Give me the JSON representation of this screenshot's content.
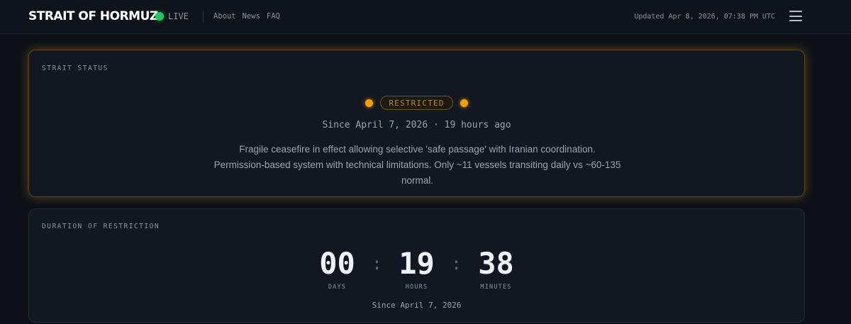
{
  "header": {
    "brand": "STRAIT OF HORMUZ",
    "live_label": "LIVE",
    "nav": [
      "About",
      "News",
      "FAQ"
    ],
    "updated": "Updated Apr 8, 2026, 07:38 PM UTC"
  },
  "status_card": {
    "title": "STRAIT STATUS",
    "status": "RESTRICTED",
    "since": "Since April 7, 2026 · 19 hours ago",
    "description": "Fragile ceasefire in effect allowing selective 'safe passage' with Iranian coordination. Permission-based system with technical limitations. Only ~11 vessels transiting daily vs ~60-135 normal."
  },
  "duration_card": {
    "title": "DURATION OF RESTRICTION",
    "days": "00",
    "days_label": "DAYS",
    "hours": "19",
    "hours_label": "HOURS",
    "minutes": "38",
    "minutes_label": "MINUTES",
    "separator": ":",
    "since": "Since April 7, 2026"
  },
  "colors": {
    "live": "#22c55e",
    "restricted": "#f59e0b",
    "background": "#0d1117"
  },
  "icons": [
    "live-status-dot",
    "menu-icon",
    "status-indicator-dot"
  ]
}
